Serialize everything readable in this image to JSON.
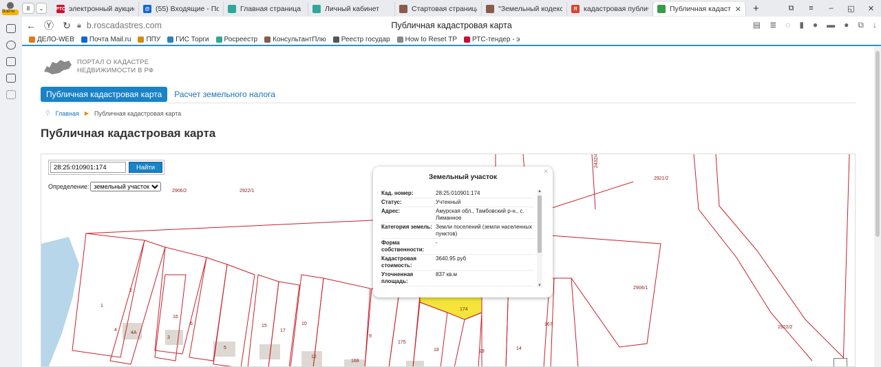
{
  "browser": {
    "profile_label": "Войти",
    "tab_counter": "8",
    "tabs": [
      {
        "title": "электронный аукцис",
        "fav_text": "PTC",
        "fav_color": "#c8102e"
      },
      {
        "title": "(55) Входящие - Поч",
        "fav_text": "@",
        "fav_color": "#1268d3"
      },
      {
        "title": "Главная страница",
        "fav_text": "",
        "fav_color": "#2fa89a"
      },
      {
        "title": "Личный кабинет",
        "fav_text": "",
        "fav_color": "#2fa89a"
      },
      {
        "title": "Стартовая страница",
        "fav_text": "",
        "fav_color": "#8a5a4a"
      },
      {
        "title": "\"Земельный кодекс Р",
        "fav_text": "",
        "fav_color": "#8a5a4a"
      },
      {
        "title": "кадастровая публич",
        "fav_text": "Я",
        "fav_color": "#e0402f"
      },
      {
        "title": "Публичная кадаст",
        "fav_text": "",
        "fav_color": "#3a9b4a"
      }
    ],
    "new_tab": "+",
    "window_controls": [
      "⧉",
      "≡",
      "–",
      "◱",
      "✕"
    ],
    "url": "b.roscadastres.com",
    "page_title": "Публичная кадастровая карта",
    "bookmarks": [
      {
        "label": "ДЕЛО-WEB",
        "color": "#e07a1b"
      },
      {
        "label": "Почта Mail.ru",
        "color": "#1268d3"
      },
      {
        "label": "ППУ",
        "color": "#d38b14"
      },
      {
        "label": "ГИС Торги",
        "color": "#2f7fc1"
      },
      {
        "label": "Росреестр",
        "color": "#2fa89a"
      },
      {
        "label": "КонсультантПлю",
        "color": "#8a5a4a"
      },
      {
        "label": "Реестр государ",
        "color": "#555555"
      },
      {
        "label": "How to Reset TP",
        "color": "#888888"
      },
      {
        "label": "РТС-тендер - э",
        "color": "#c8102e"
      }
    ]
  },
  "site": {
    "logo_line1": "ПОРТАЛ О КАДАСТРЕ",
    "logo_line2": "НЕДВИЖИМОСТИ В РФ",
    "nav_active": "Публичная кадастровая карта",
    "nav_link": "Расчет земельного налога",
    "breadcrumb_home": "Главная",
    "breadcrumb_current": "Публичная кадастровая карта",
    "heading": "Публичная кадастровая карта"
  },
  "map": {
    "search_value": "28:25:010901:174",
    "search_button": "Найти",
    "definition_label": "Определение:",
    "definition_value": "земельный участок",
    "highlight_color": "#f5e43a",
    "parcel_color": "#c8202a",
    "water_color": "#b7d6ea",
    "parcel_labels": [
      "2906/2",
      "2922/1",
      "2432/4",
      "2921/2",
      "1",
      "2",
      "4",
      "4А",
      "3",
      "16",
      "6",
      "5",
      "15",
      "17",
      "10",
      "12",
      "168",
      "9",
      "175",
      "18",
      "174",
      "19",
      "14",
      "167",
      "2906/1",
      "2922/2"
    ],
    "popup": {
      "title": "Земельный участок",
      "rows": [
        {
          "key": "Кад. номер:",
          "value": "28:25:010901:174"
        },
        {
          "key": "Статус:",
          "value": "Учтенный"
        },
        {
          "key": "Адрес:",
          "value": "Амурская обл., Тамбовский р-н., с. Лиманное"
        },
        {
          "key": "Категория земель:",
          "value": "Земли поселений (земли населенных пунктов)"
        },
        {
          "key": "Форма собственности:",
          "value": "-"
        },
        {
          "key": "Кадастровая стоимость:",
          "value": "3640.95 руб"
        },
        {
          "key": "Уточненная площадь:",
          "value": "837 кв.м"
        }
      ]
    }
  }
}
